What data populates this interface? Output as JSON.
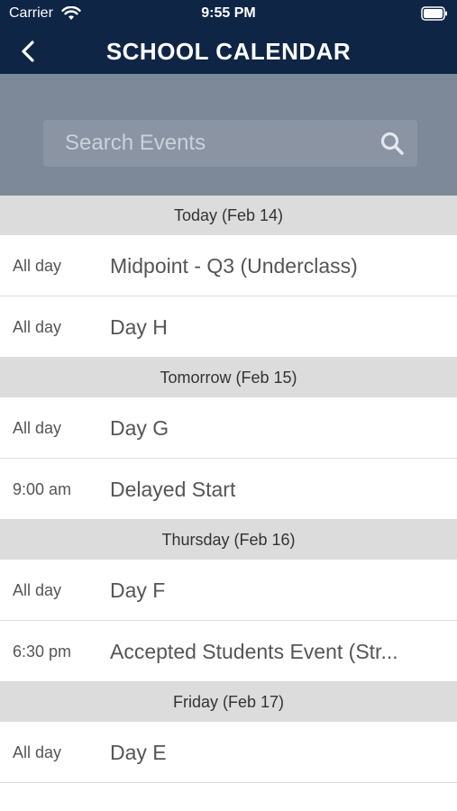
{
  "status_bar": {
    "carrier": "Carrier",
    "time": "9:55 PM"
  },
  "nav": {
    "title": "SCHOOL CALENDAR",
    "back_icon": "chevron-left-icon"
  },
  "search": {
    "placeholder": "Search Events",
    "value": "",
    "icon": "search-icon"
  },
  "sections": [
    {
      "header": "Today (Feb 14)",
      "events": [
        {
          "time": "All day",
          "title": "Midpoint - Q3 (Underclass)"
        },
        {
          "time": "All day",
          "title": "Day H"
        }
      ]
    },
    {
      "header": "Tomorrow (Feb 15)",
      "events": [
        {
          "time": "All day",
          "title": "Day G"
        },
        {
          "time": "9:00 am",
          "title": "Delayed Start"
        }
      ]
    },
    {
      "header": "Thursday (Feb 16)",
      "events": [
        {
          "time": "All day",
          "title": "Day F"
        },
        {
          "time": "6:30 pm",
          "title": "Accepted Students Event (Str..."
        }
      ]
    },
    {
      "header": "Friday (Feb 17)",
      "events": [
        {
          "time": "All day",
          "title": "Day E"
        }
      ]
    }
  ],
  "colors": {
    "nav_background": "#0f2546",
    "search_area_background": "#7d8898",
    "section_header_background": "#dcdcdc",
    "text": "#555555"
  }
}
